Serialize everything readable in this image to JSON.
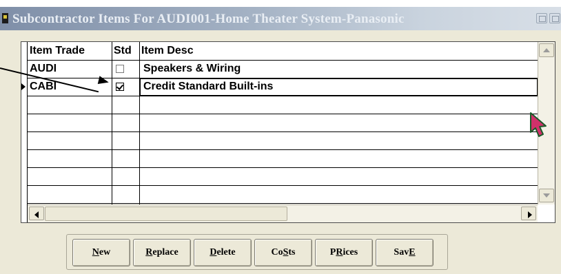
{
  "window": {
    "title": "Subcontractor Items For AUDI001-Home Theater System-Panasonic"
  },
  "grid": {
    "columns": [
      "Item Trade",
      "Std",
      "Item Desc"
    ],
    "rows": [
      {
        "trade": "AUDI",
        "std": false,
        "desc": "Speakers & Wiring"
      },
      {
        "trade": "CABI",
        "std": true,
        "desc": "Credit Standard Built-ins"
      }
    ],
    "current_row_index": 1
  },
  "buttons": {
    "new_a": "",
    "new_k": "N",
    "new_b": "ew",
    "replace_a": "",
    "replace_k": "R",
    "replace_b": "eplace",
    "delete_a": "",
    "delete_k": "D",
    "delete_b": "elete",
    "costs_a": "Co",
    "costs_k": "S",
    "costs_b": "ts",
    "prices_a": "P",
    "prices_k": "R",
    "prices_b": "ices",
    "save_a": "Sav",
    "save_k": "E",
    "save_b": ""
  },
  "colors": {
    "titlebar_start": "#7f8fa8",
    "face": "#ece9d8",
    "cursor": "#d0306a"
  },
  "icons": [
    "app-icon",
    "minimize-icon",
    "maximize-icon",
    "scroll-up-icon",
    "scroll-down-icon",
    "scroll-left-icon",
    "scroll-right-icon",
    "row-indicator-icon",
    "checkbox-checked-icon",
    "annotation-arrow-icon",
    "mouse-cursor-icon"
  ]
}
